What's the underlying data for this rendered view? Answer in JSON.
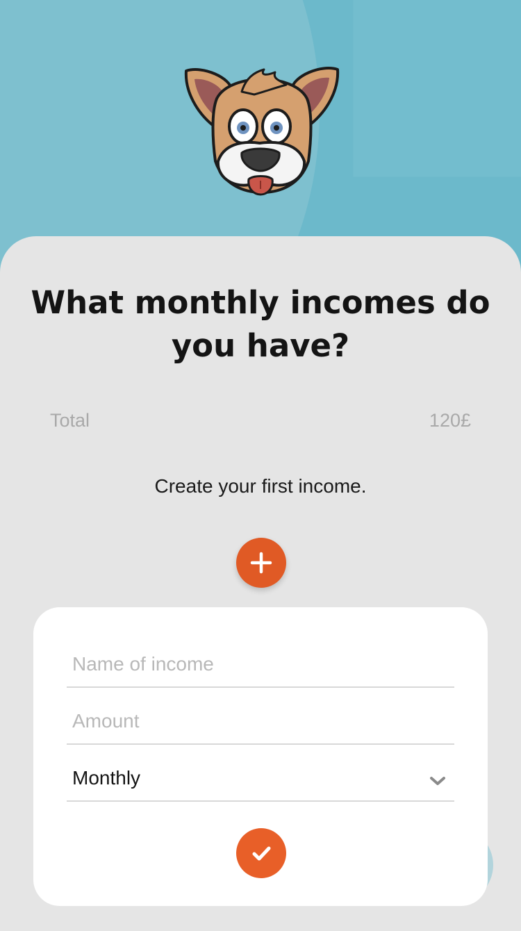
{
  "header": {
    "logo_icon": "dog-face-icon"
  },
  "main": {
    "title": "What monthly incomes do you have?",
    "total_label": "Total",
    "total_value": "120£",
    "empty_message": "Create your first income.",
    "add_icon": "plus-icon"
  },
  "form": {
    "name_placeholder": "Name of income",
    "name_value": "",
    "amount_placeholder": "Amount",
    "amount_value": "",
    "frequency_value": "Monthly",
    "frequency_icon": "chevron-down-icon",
    "confirm_icon": "checkmark-icon"
  },
  "colors": {
    "background": "#6cb9cb",
    "panel": "#e5e5e5",
    "accent": "#e05a25",
    "card": "#ffffff"
  }
}
